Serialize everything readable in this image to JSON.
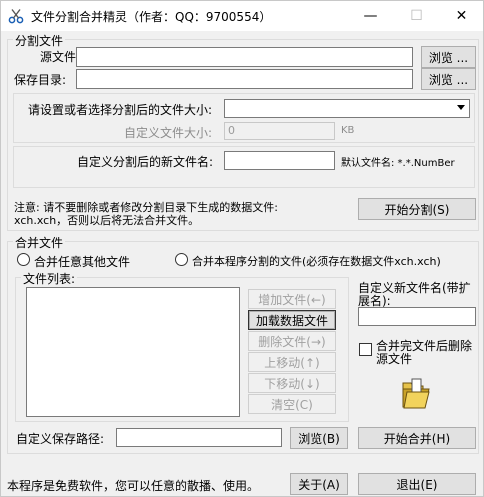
{
  "window": {
    "title": "文件分割合并精灵（作者：QQ：9700554）",
    "minimize": "—",
    "maximize": "☐",
    "close": "✕"
  },
  "split": {
    "group_title": "分割文件",
    "source_label": "源文件:",
    "source_value": "",
    "save_dir_label": "保存目录:",
    "save_dir_value": "",
    "browse_label": "浏览 ...",
    "size_label": "请设置或者选择分割后的文件大小:",
    "size_value": "",
    "custom_size_label": "自定义文件大小:",
    "custom_size_value": "0",
    "custom_size_unit": "KB",
    "new_name_label": "自定义分割后的新文件名:",
    "new_name_value": "",
    "default_name_label": "默认文件名: *.*.NumBer",
    "note_line1": "注意: 请不要删除或者修改分割目录下生成的数据文件:",
    "note_line2": "xch.xch，否则以后将无法合并文件。",
    "start_split_label": "开始分割(S)"
  },
  "merge": {
    "group_title": "合并文件",
    "radio_any": "合并任意其他文件",
    "radio_own": "合并本程序分割的文件(必须存在数据文件xch.xch)",
    "file_list_label": "文件列表:",
    "buttons": {
      "add": "增加文件(←)",
      "load": "加载数据文件",
      "delete": "删除文件(→)",
      "up": "上移动(↑)",
      "down": "下移动(↓)",
      "clear": "清空(C)"
    },
    "new_name_label_1": "自定义新文件名(带扩",
    "new_name_label_2": "展名):",
    "new_name_value": "",
    "delete_after_1": "合并完文件后删除",
    "delete_after_2": "源文件",
    "save_path_label": "自定义保存路径:",
    "save_path_value": "",
    "browse_label": "浏览(B)",
    "start_merge_label": "开始合并(H)"
  },
  "footer": {
    "freeware_text": "本程序是免费软件，您可以任意的散播、使用。",
    "about_label": "关于(A)",
    "exit_label": "退出(E)"
  },
  "icons": [
    "app-scissors-icon",
    "folder-icon",
    "dropdown-arrow-icon"
  ]
}
